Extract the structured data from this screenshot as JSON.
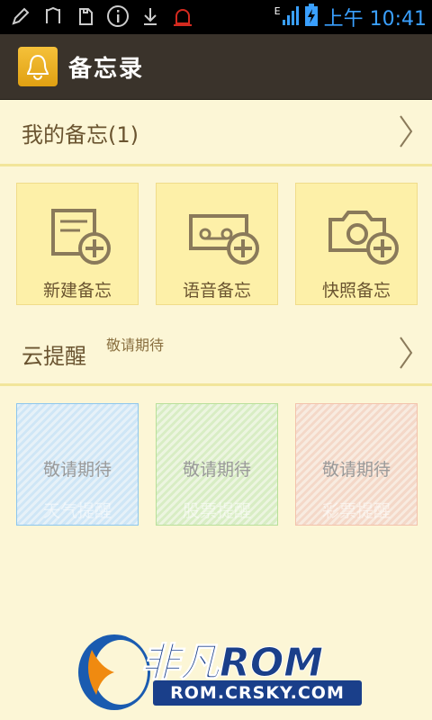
{
  "status_bar": {
    "time": "上午 10:41",
    "network": "E"
  },
  "title_bar": {
    "title": "备忘录"
  },
  "my_memos": {
    "label": "我的备忘(1)"
  },
  "memo_tiles": [
    {
      "label": "新建备忘",
      "icon": "new-memo-icon"
    },
    {
      "label": "语音备忘",
      "icon": "voice-memo-icon"
    },
    {
      "label": "快照备忘",
      "icon": "snapshot-memo-icon"
    }
  ],
  "cloud_reminder": {
    "label": "云提醒",
    "badge": "敬请期待"
  },
  "pending_tiles": [
    {
      "status": "敬请期待",
      "label": "天气提醒",
      "color": "#6fb8e8"
    },
    {
      "status": "敬请期待",
      "label": "股票提醒",
      "color": "#9ed479"
    },
    {
      "status": "敬请期待",
      "label": "彩票提醒",
      "color": "#f0a98a"
    }
  ],
  "watermark": {
    "brand": "非凡ROM",
    "site": "ROM.CRSKY.COM"
  },
  "colors": {
    "background": "#fcf6d6",
    "titlebar": "#3a332b",
    "tile": "#fdf0a8",
    "text": "#6a5430"
  }
}
